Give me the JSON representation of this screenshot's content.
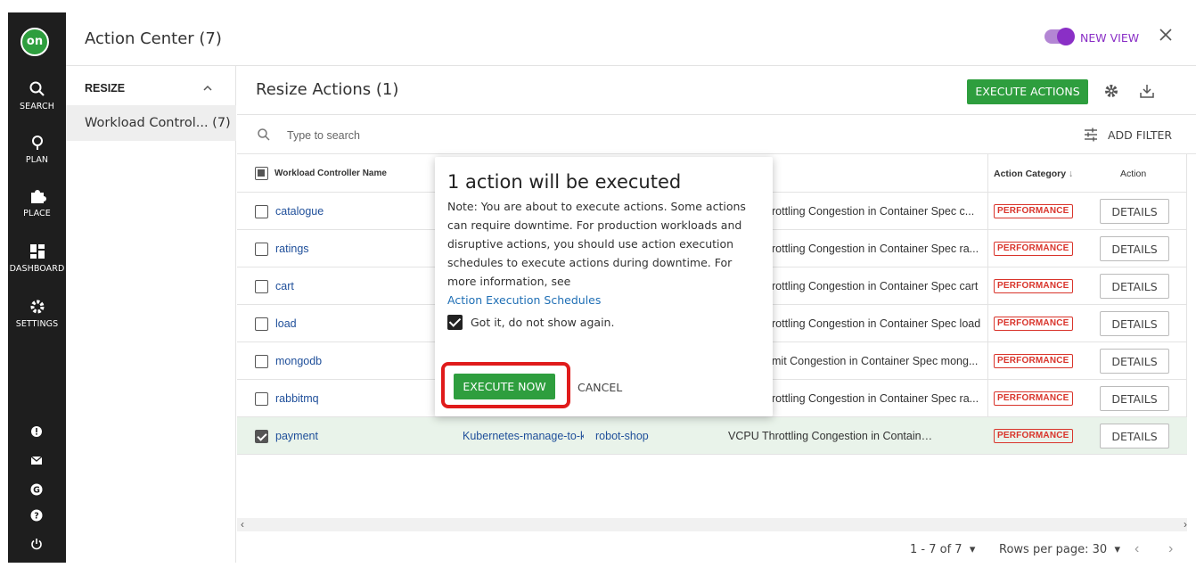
{
  "app": {
    "logo_text": "on",
    "title": "Action Center (7)",
    "new_view_label": "NEW VIEW",
    "new_view_on": true
  },
  "nav": {
    "items": [
      {
        "label": "SEARCH",
        "icon": "search-icon"
      },
      {
        "label": "PLAN",
        "icon": "lightbulb-icon"
      },
      {
        "label": "PLACE",
        "icon": "puzzle-icon"
      },
      {
        "label": "DASHBOARD",
        "icon": "dashboard-icon"
      },
      {
        "label": "SETTINGS",
        "icon": "gear-icon"
      }
    ],
    "bottom_icons": [
      "alert-icon",
      "mail-icon",
      "google-icon",
      "help-icon",
      "power-icon"
    ]
  },
  "sidebar": {
    "section": "RESIZE",
    "item": "Workload Control... (7)"
  },
  "main": {
    "title": "Resize Actions (1)",
    "execute_label": "EXECUTE ACTIONS",
    "search_placeholder": "Type to search",
    "add_filter_label": "ADD FILTER"
  },
  "table": {
    "headers": {
      "name": "Workload Controller Name",
      "category": "Action Category",
      "action": "Action"
    },
    "rows": [
      {
        "name": "catalogue",
        "controller": "",
        "namespace": "",
        "details": "rottling Congestion in Container Spec c...",
        "category": "PERFORMANCE",
        "action": "DETAILS",
        "checked": false
      },
      {
        "name": "ratings",
        "controller": "",
        "namespace": "",
        "details": "rottling Congestion in Container Spec ra...",
        "category": "PERFORMANCE",
        "action": "DETAILS",
        "checked": false
      },
      {
        "name": "cart",
        "controller": "",
        "namespace": "",
        "details": "rottling Congestion in Container Spec cart",
        "category": "PERFORMANCE",
        "action": "DETAILS",
        "checked": false
      },
      {
        "name": "load",
        "controller": "",
        "namespace": "",
        "details": "rottling Congestion in Container Spec load",
        "category": "PERFORMANCE",
        "action": "DETAILS",
        "checked": false
      },
      {
        "name": "mongodb",
        "controller": "",
        "namespace": "",
        "details": "mit Congestion in Container Spec mong...",
        "category": "PERFORMANCE",
        "action": "DETAILS",
        "checked": false
      },
      {
        "name": "rabbitmq",
        "controller": "",
        "namespace": "",
        "details": "rottling Congestion in Container Spec ra...",
        "category": "PERFORMANCE",
        "action": "DETAILS",
        "checked": false
      },
      {
        "name": "payment",
        "controller": "Kubernetes-manage-to-k",
        "namespace": "robot-shop",
        "details": "VCPU Throttling Congestion in Container Spec p...",
        "category": "PERFORMANCE",
        "action": "DETAILS",
        "checked": true
      }
    ]
  },
  "footer": {
    "pager": "1 - 7 of 7",
    "rows_per_page": "Rows per page: 30"
  },
  "modal": {
    "title": "1 action will be executed",
    "note": "Note: You are about to execute actions. Some actions can require downtime. For production workloads and disruptive actions, you should use action execution schedules to execute actions during downtime. For more information, see",
    "link": "Action Execution Schedules",
    "checkbox_label": "Got it, do not show again.",
    "execute_label": "EXECUTE NOW",
    "cancel_label": "CANCEL"
  },
  "colors": {
    "accent": "#2e9e3e",
    "highlight": "#e01b1b",
    "badge": "#d9342b",
    "toggle": "#8a2fc6"
  }
}
